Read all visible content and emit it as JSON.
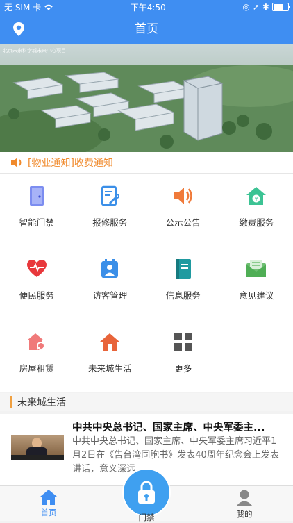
{
  "status": {
    "carrier": "无 SIM 卡",
    "time": "下午4:50"
  },
  "nav": {
    "title": "首页"
  },
  "banner": {
    "caption": "北京未来科学城未来中心项目"
  },
  "notice": {
    "text": "[物业通知]收费通知"
  },
  "services": [
    {
      "label": "智能门禁",
      "icon": "door-icon"
    },
    {
      "label": "报修服务",
      "icon": "repair-icon"
    },
    {
      "label": "公示公告",
      "icon": "speaker-icon"
    },
    {
      "label": "缴费服务",
      "icon": "payment-icon"
    },
    {
      "label": "便民服务",
      "icon": "heart-icon"
    },
    {
      "label": "访客管理",
      "icon": "visitor-icon"
    },
    {
      "label": "信息服务",
      "icon": "book-icon"
    },
    {
      "label": "意见建议",
      "icon": "mail-icon"
    },
    {
      "label": "房屋租赁",
      "icon": "house-key-icon"
    },
    {
      "label": "未来城生活",
      "icon": "home-icon"
    },
    {
      "label": "更多",
      "icon": "grid-icon"
    }
  ],
  "section": {
    "title": "未来城生活"
  },
  "news": {
    "headline": "中共中央总书记、国家主席、中央军委主...",
    "body": "中共中央总书记、国家主席、中央军委主席习近平1月2日在《告台湾同胞书》发表40周年纪念会上发表讲话，意义深远"
  },
  "tabs": {
    "home": "首页",
    "door": "门禁",
    "mine": "我的"
  },
  "colors": {
    "primary": "#3f8ef2",
    "notice": "#f08a2c",
    "accent_bar": "#f0a040"
  }
}
